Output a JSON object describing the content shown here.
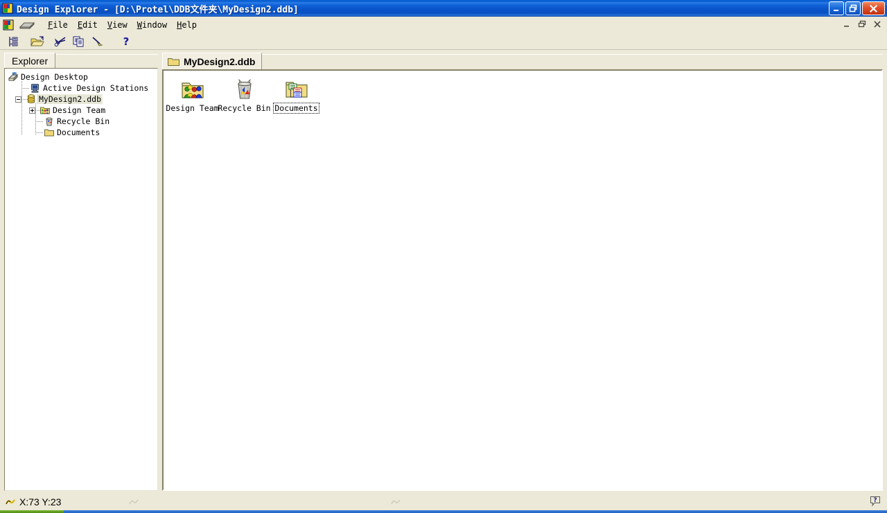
{
  "window": {
    "app_name": "Design Explorer",
    "title": "Design Explorer - [D:\\Protel\\DDB文件夹\\MyDesign2.ddb]",
    "app_icon": "protel-app-icon",
    "buttons": {
      "minimize": "minimize-icon",
      "restore": "restore-icon",
      "close": "close-icon"
    }
  },
  "menubar": {
    "doc_icon": "document-icon",
    "items": [
      {
        "label": "File",
        "accel": "F"
      },
      {
        "label": "Edit",
        "accel": "E"
      },
      {
        "label": "View",
        "accel": "V"
      },
      {
        "label": "Window",
        "accel": "W"
      },
      {
        "label": "Help",
        "accel": "H"
      }
    ],
    "mdi_buttons": {
      "minimize": "mdi-minimize-icon",
      "restore": "mdi-restore-icon",
      "close": "mdi-close-icon"
    }
  },
  "toolbar": {
    "buttons": [
      {
        "name": "explorer-panel-toggle-icon",
        "title": "Toggle Design Explorer panel"
      },
      {
        "name": "open-folder-icon",
        "title": "Open"
      },
      {
        "name": "cut-icon",
        "title": "Cut"
      },
      {
        "name": "copy-icon",
        "title": "Copy"
      },
      {
        "name": "paste-wand-icon",
        "title": "Paste"
      },
      {
        "name": "help-question-icon",
        "title": "Help"
      }
    ]
  },
  "explorer": {
    "tab_label": "Explorer",
    "tree": [
      {
        "label": "Design Desktop",
        "icon": "design-desktop-icon",
        "indent": 0,
        "expander": "none",
        "selected": false
      },
      {
        "label": "Active Design Stations",
        "icon": "active-design-stations-icon",
        "indent": 1,
        "expander": "none",
        "selected": false
      },
      {
        "label": "MyDesign2.ddb",
        "icon": "database-ddb-icon",
        "indent": 1,
        "expander": "minus",
        "selected": true
      },
      {
        "label": "Design Team",
        "icon": "design-team-folder-icon",
        "indent": 2,
        "expander": "plus",
        "selected": false
      },
      {
        "label": "Recycle Bin",
        "icon": "recycle-bin-icon",
        "indent": 2,
        "expander": "none",
        "selected": false
      },
      {
        "label": "Documents",
        "icon": "documents-folder-icon",
        "indent": 2,
        "expander": "none",
        "selected": false
      }
    ]
  },
  "main": {
    "tab": {
      "label": "MyDesign2.ddb",
      "icon": "folder-tab-icon"
    },
    "items": [
      {
        "label": "Design Team",
        "icon": "design-team-folder-icon",
        "focused": false
      },
      {
        "label": "Recycle Bin",
        "icon": "recycle-bin-icon",
        "focused": false
      },
      {
        "label": "Documents",
        "icon": "documents-folder-icon",
        "focused": true
      }
    ]
  },
  "statusbar": {
    "cursor_icon": "cursor-arrow-icon",
    "coordinates": "X:73 Y:23",
    "help_icon": "help-balloon-icon"
  },
  "colors": {
    "titlebar_blue": "#0a54c8",
    "close_red": "#c2300f",
    "window_face": "#ece9d8",
    "canvas_white": "#ffffff",
    "folder_yellow": "#f7e08a",
    "folder_border": "#6b6b3a",
    "selection_tint": "#e8e8d8",
    "taskbar_blue": "#1f62c8",
    "start_green": "#4e8c12"
  }
}
